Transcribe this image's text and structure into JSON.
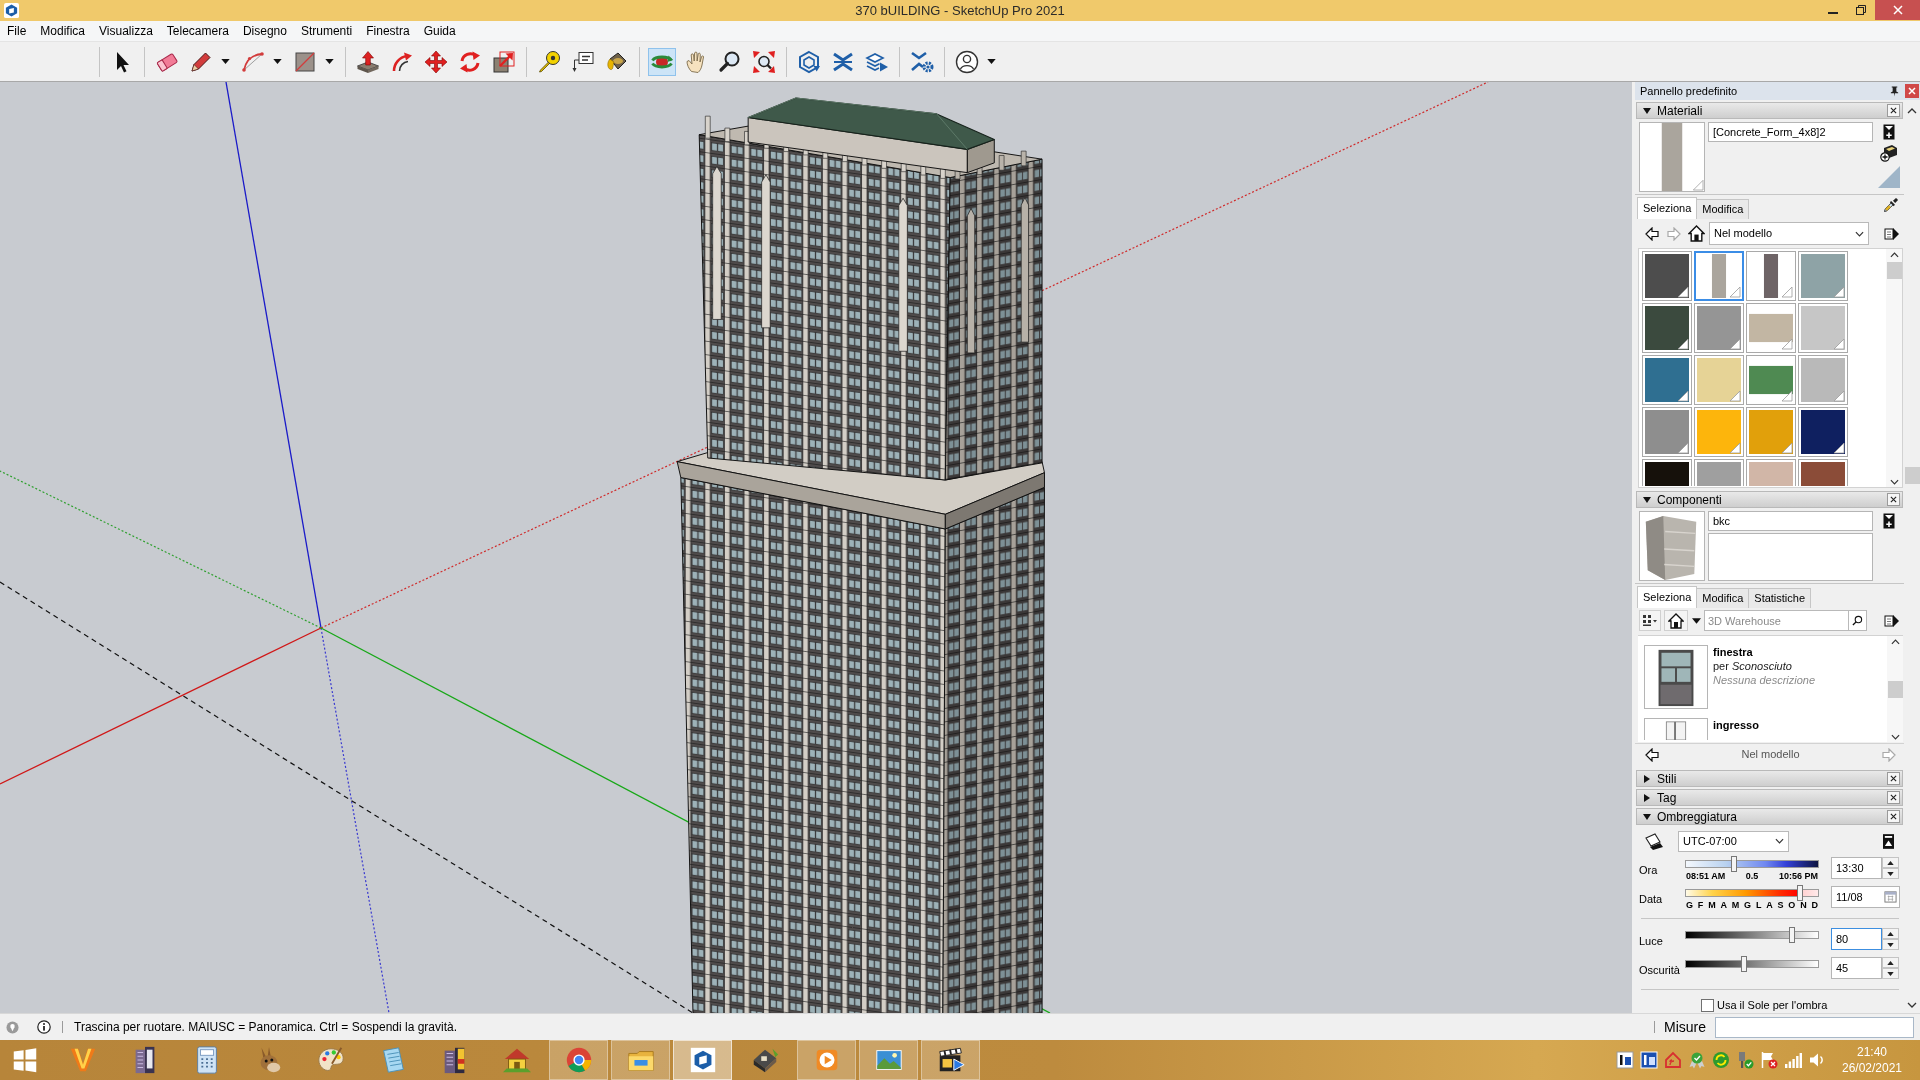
{
  "window": {
    "title": "370 bUILDING - SketchUp Pro 2021"
  },
  "menu": [
    "File",
    "Modifica",
    "Visualizza",
    "Telecamera",
    "Disegno",
    "Strumenti",
    "Finestra",
    "Guida"
  ],
  "toolbar": [
    [
      {
        "kind": "select",
        "selected": false,
        "dropdown": false
      }
    ],
    [
      {
        "kind": "eraser",
        "selected": false,
        "dropdown": false
      },
      {
        "kind": "line",
        "selected": false,
        "dropdown": true
      },
      {
        "kind": "arc",
        "selected": false,
        "dropdown": true
      },
      {
        "kind": "rectangle",
        "selected": false,
        "dropdown": true
      }
    ],
    [
      {
        "kind": "pushpull",
        "selected": false,
        "dropdown": false
      },
      {
        "kind": "offset",
        "selected": false,
        "dropdown": false
      },
      {
        "kind": "move",
        "selected": false,
        "dropdown": false
      },
      {
        "kind": "rotate",
        "selected": false,
        "dropdown": false
      },
      {
        "kind": "scale",
        "selected": false,
        "dropdown": false
      }
    ],
    [
      {
        "kind": "tape",
        "selected": false,
        "dropdown": false
      },
      {
        "kind": "text",
        "selected": false,
        "dropdown": false
      },
      {
        "kind": "paint",
        "selected": false,
        "dropdown": false
      }
    ],
    [
      {
        "kind": "orbit",
        "selected": true,
        "dropdown": false
      },
      {
        "kind": "pan",
        "selected": false,
        "dropdown": false
      },
      {
        "kind": "zoom",
        "selected": false,
        "dropdown": false
      },
      {
        "kind": "extents",
        "selected": false,
        "dropdown": false
      }
    ],
    [
      {
        "kind": "warehouse",
        "selected": false,
        "dropdown": false
      },
      {
        "kind": "extensions",
        "selected": false,
        "dropdown": false
      },
      {
        "kind": "layout",
        "selected": false,
        "dropdown": false
      }
    ],
    [
      {
        "kind": "manager",
        "selected": false,
        "dropdown": false
      }
    ],
    [
      {
        "kind": "profile",
        "selected": false,
        "dropdown": true
      }
    ]
  ],
  "tray": {
    "title": "Pannello predefinito",
    "materials": {
      "title": "Materiali",
      "expanded": true,
      "name": "[Concrete_Form_4x8]2",
      "tabs": [
        {
          "label": "Seleziona",
          "selected": true
        },
        {
          "label": "Modifica",
          "selected": false
        }
      ],
      "nav": {
        "back_disabled": false,
        "forward_disabled": true
      },
      "collection": "Nel modello",
      "swatches": [
        {
          "kind": "solid",
          "color": "#4d4d4d",
          "selected": false
        },
        {
          "kind": "strip",
          "color": "#aaa59d",
          "selected": true
        },
        {
          "kind": "strip",
          "color": "#6e6466",
          "selected": false
        },
        {
          "kind": "solid",
          "color": "#8ea3a6",
          "selected": false
        },
        {
          "kind": "solid",
          "color": "#3b4a3e",
          "selected": false
        },
        {
          "kind": "solid",
          "color": "#959595",
          "selected": false
        },
        {
          "kind": "band",
          "color": "#c2b6a3",
          "selected": false
        },
        {
          "kind": "solid",
          "color": "#c6c6c6",
          "selected": false
        },
        {
          "kind": "solid",
          "color": "#2f6f91",
          "selected": false
        },
        {
          "kind": "solid",
          "color": "#e6d396",
          "selected": false
        },
        {
          "kind": "band",
          "color": "#4f8a52",
          "selected": false
        },
        {
          "kind": "solid",
          "color": "#b9b9b9",
          "selected": false
        },
        {
          "kind": "solid",
          "color": "#8e8e8e",
          "selected": false
        },
        {
          "kind": "solid",
          "color": "#fdb50c",
          "selected": false
        },
        {
          "kind": "solid",
          "color": "#e1a00b",
          "selected": false
        },
        {
          "kind": "solid",
          "color": "#0f2060",
          "selected": false
        },
        {
          "kind": "solid",
          "color": "#16110b",
          "selected": false
        },
        {
          "kind": "solid",
          "color": "#9f9f9f",
          "selected": false
        },
        {
          "kind": "solid",
          "color": "#d1b6a7",
          "selected": false
        },
        {
          "kind": "solid",
          "color": "#8b4c38",
          "selected": false
        }
      ]
    },
    "components": {
      "title": "Componenti",
      "expanded": true,
      "name": "bkc",
      "tabs": [
        {
          "label": "Seleziona",
          "selected": true
        },
        {
          "label": "Modifica",
          "selected": false
        },
        {
          "label": "Statistiche",
          "selected": false
        }
      ],
      "search": {
        "placeholder": "3D Warehouse"
      },
      "items": [
        {
          "name": "finestra",
          "author": "per *Sconosciuto*",
          "description": "Nessuna descrizione"
        },
        {
          "name": "ingresso"
        }
      ],
      "footer_nav": {
        "back_disabled": false,
        "forward_disabled": true
      },
      "collection": "Nel modello"
    },
    "sections": [
      {
        "title": "Stili",
        "expanded": false
      },
      {
        "title": "Tag",
        "expanded": false
      }
    ],
    "shadows": {
      "title": "Ombreggiatura",
      "expanded": true,
      "timezone": "UTC-07:00",
      "sliders": [
        {
          "kind": "time",
          "label": "Ora",
          "level": 0.36,
          "scale": [
            "08:51 AM",
            "0.5",
            "10:56 PM"
          ],
          "value": "13:30",
          "focused": false
        },
        {
          "kind": "date",
          "label": "Data",
          "level": 0.86,
          "scale": [
            "G",
            "F",
            "M",
            "A",
            "M",
            "G",
            "L",
            "A",
            "S",
            "O",
            "N",
            "D"
          ],
          "value": "11/08",
          "focused": false
        },
        {
          "kind": "light",
          "label": "Luce",
          "level": 0.8,
          "value": "80",
          "focused": true
        },
        {
          "kind": "dark",
          "label": "Oscurità",
          "level": 0.44,
          "value": "45",
          "focused": false
        }
      ],
      "use_sun": {
        "label": "Usa il Sole per l'ombra",
        "checked": false
      }
    }
  },
  "status_bar": {
    "hint": "Trascina per ruotare. MAIUSC = Panoramica. Ctrl = Sospendi la gravità.",
    "measurements_label": "Misure"
  },
  "taskbar": {
    "apps": [
      {
        "kind": "start",
        "running": false,
        "selected": false
      },
      {
        "kind": "vlogo",
        "running": false,
        "selected": false
      },
      {
        "kind": "tower",
        "running": false,
        "selected": false
      },
      {
        "kind": "calculator",
        "running": false,
        "selected": false
      },
      {
        "kind": "donkey",
        "running": false,
        "selected": false
      },
      {
        "kind": "palette",
        "running": false,
        "selected": false
      },
      {
        "kind": "notepad",
        "running": false,
        "selected": false
      },
      {
        "kind": "towersign",
        "running": false,
        "selected": false
      },
      {
        "kind": "house",
        "running": false,
        "selected": false
      },
      {
        "kind": "browser",
        "running": true,
        "selected": false
      },
      {
        "kind": "folder",
        "running": true,
        "selected": false
      },
      {
        "kind": "cube",
        "running": true,
        "selected": true
      },
      {
        "kind": "housemodel",
        "running": false,
        "selected": false
      },
      {
        "kind": "player",
        "running": true,
        "selected": false
      },
      {
        "kind": "photos",
        "running": true,
        "selected": false
      },
      {
        "kind": "clapper",
        "running": true,
        "selected": false
      }
    ],
    "tray_icons": [
      {
        "kind": "whitetile"
      },
      {
        "kind": "bluetile"
      },
      {
        "kind": "housesignal"
      },
      {
        "kind": "badge"
      },
      {
        "kind": "sync"
      },
      {
        "kind": "plug"
      },
      {
        "kind": "flag"
      },
      {
        "kind": "signal"
      },
      {
        "kind": "speaker"
      }
    ],
    "clock": {
      "time": "21:40",
      "date": "26/02/2021"
    }
  }
}
